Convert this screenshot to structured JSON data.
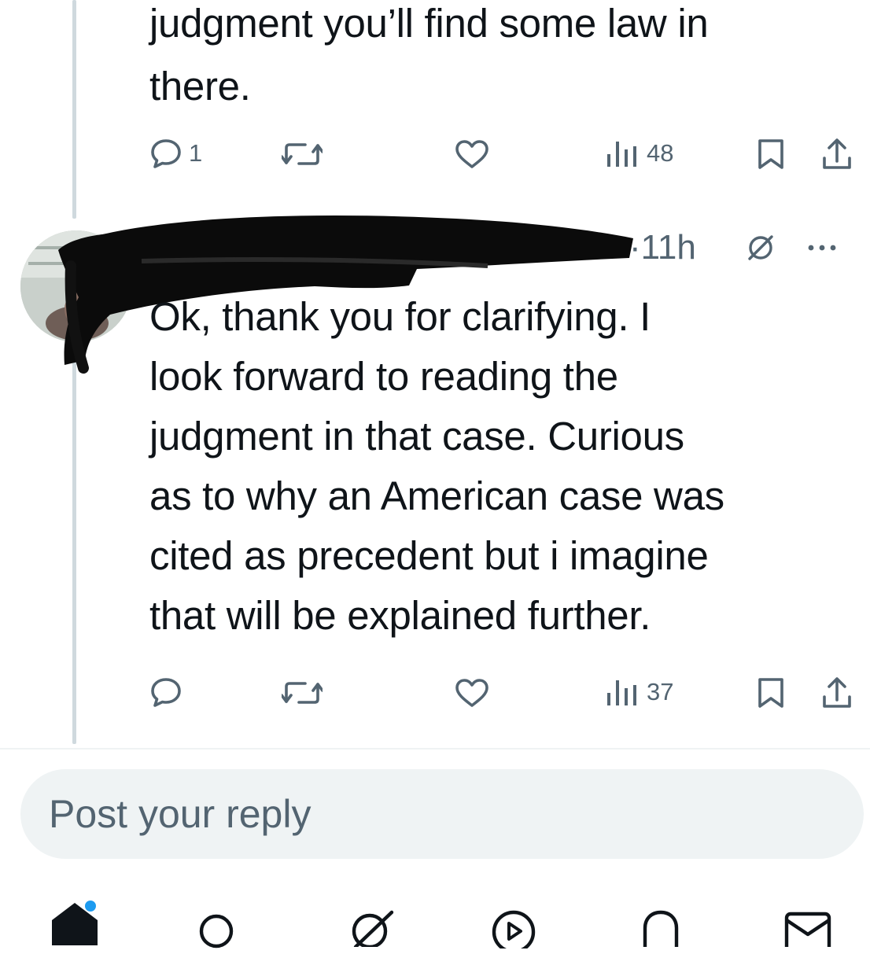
{
  "previous_post": {
    "text_line1": "judgment you’ll find some law in",
    "text_line2": "there.",
    "actions": {
      "reply_count": "1",
      "repost_count": "",
      "like_count": "",
      "views_count": "48"
    }
  },
  "reply_post": {
    "timestamp": "·11h",
    "text_lines": [
      "Ok, thank you for clarifying. I",
      "look forward to reading the",
      "judgment in that case. Curious",
      "as to why an American case was",
      "cited as precedent but i imagine",
      "that will be explained further."
    ],
    "actions": {
      "reply_count": "",
      "repost_count": "",
      "like_count": "",
      "views_count": "37"
    }
  },
  "composer": {
    "placeholder": "Post your reply"
  },
  "icons": {
    "reply": "reply-icon",
    "repost": "repost-icon",
    "like": "like-icon",
    "views": "views-icon",
    "bookmark": "bookmark-icon",
    "share": "share-icon",
    "grok": "grok-icon",
    "more": "more-icon",
    "home": "home-icon",
    "search": "search-icon",
    "grok_nav": "grok-nav-icon",
    "video": "video-icon",
    "notifications": "bell-icon",
    "messages": "mail-icon"
  },
  "colors": {
    "text": "#0f1419",
    "secondary": "#536471",
    "thread_line": "#cfd9de",
    "reply_box": "#eff3f4",
    "accent": "#1d9bf0"
  }
}
